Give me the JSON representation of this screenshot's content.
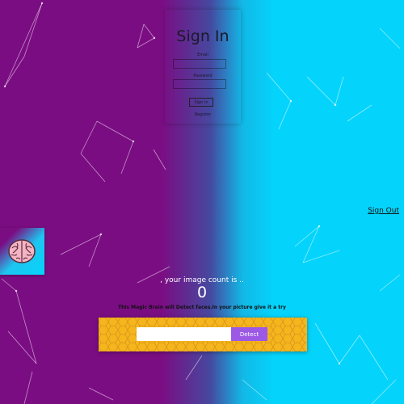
{
  "signin": {
    "title": "Sign In",
    "email_label": "Email",
    "password_label": "Password",
    "submit_label": "Sign in",
    "register_label": "Register",
    "email_value": "",
    "password_value": ""
  },
  "nav": {
    "signout_label": "Sign Out"
  },
  "logo": {
    "icon": "brain-icon"
  },
  "rank": {
    "text": ", your image count is ..",
    "count": "0"
  },
  "intro": {
    "text": "This Magic Brain will Detect faces.In your picture give it a try"
  },
  "image_form": {
    "input_value": "",
    "button_label": "Detect"
  },
  "colors": {
    "purple": "#7b0d83",
    "cyan": "#04d4fb",
    "panel_yellow": "#f5b51d",
    "button_purple": "#9c59e6"
  }
}
